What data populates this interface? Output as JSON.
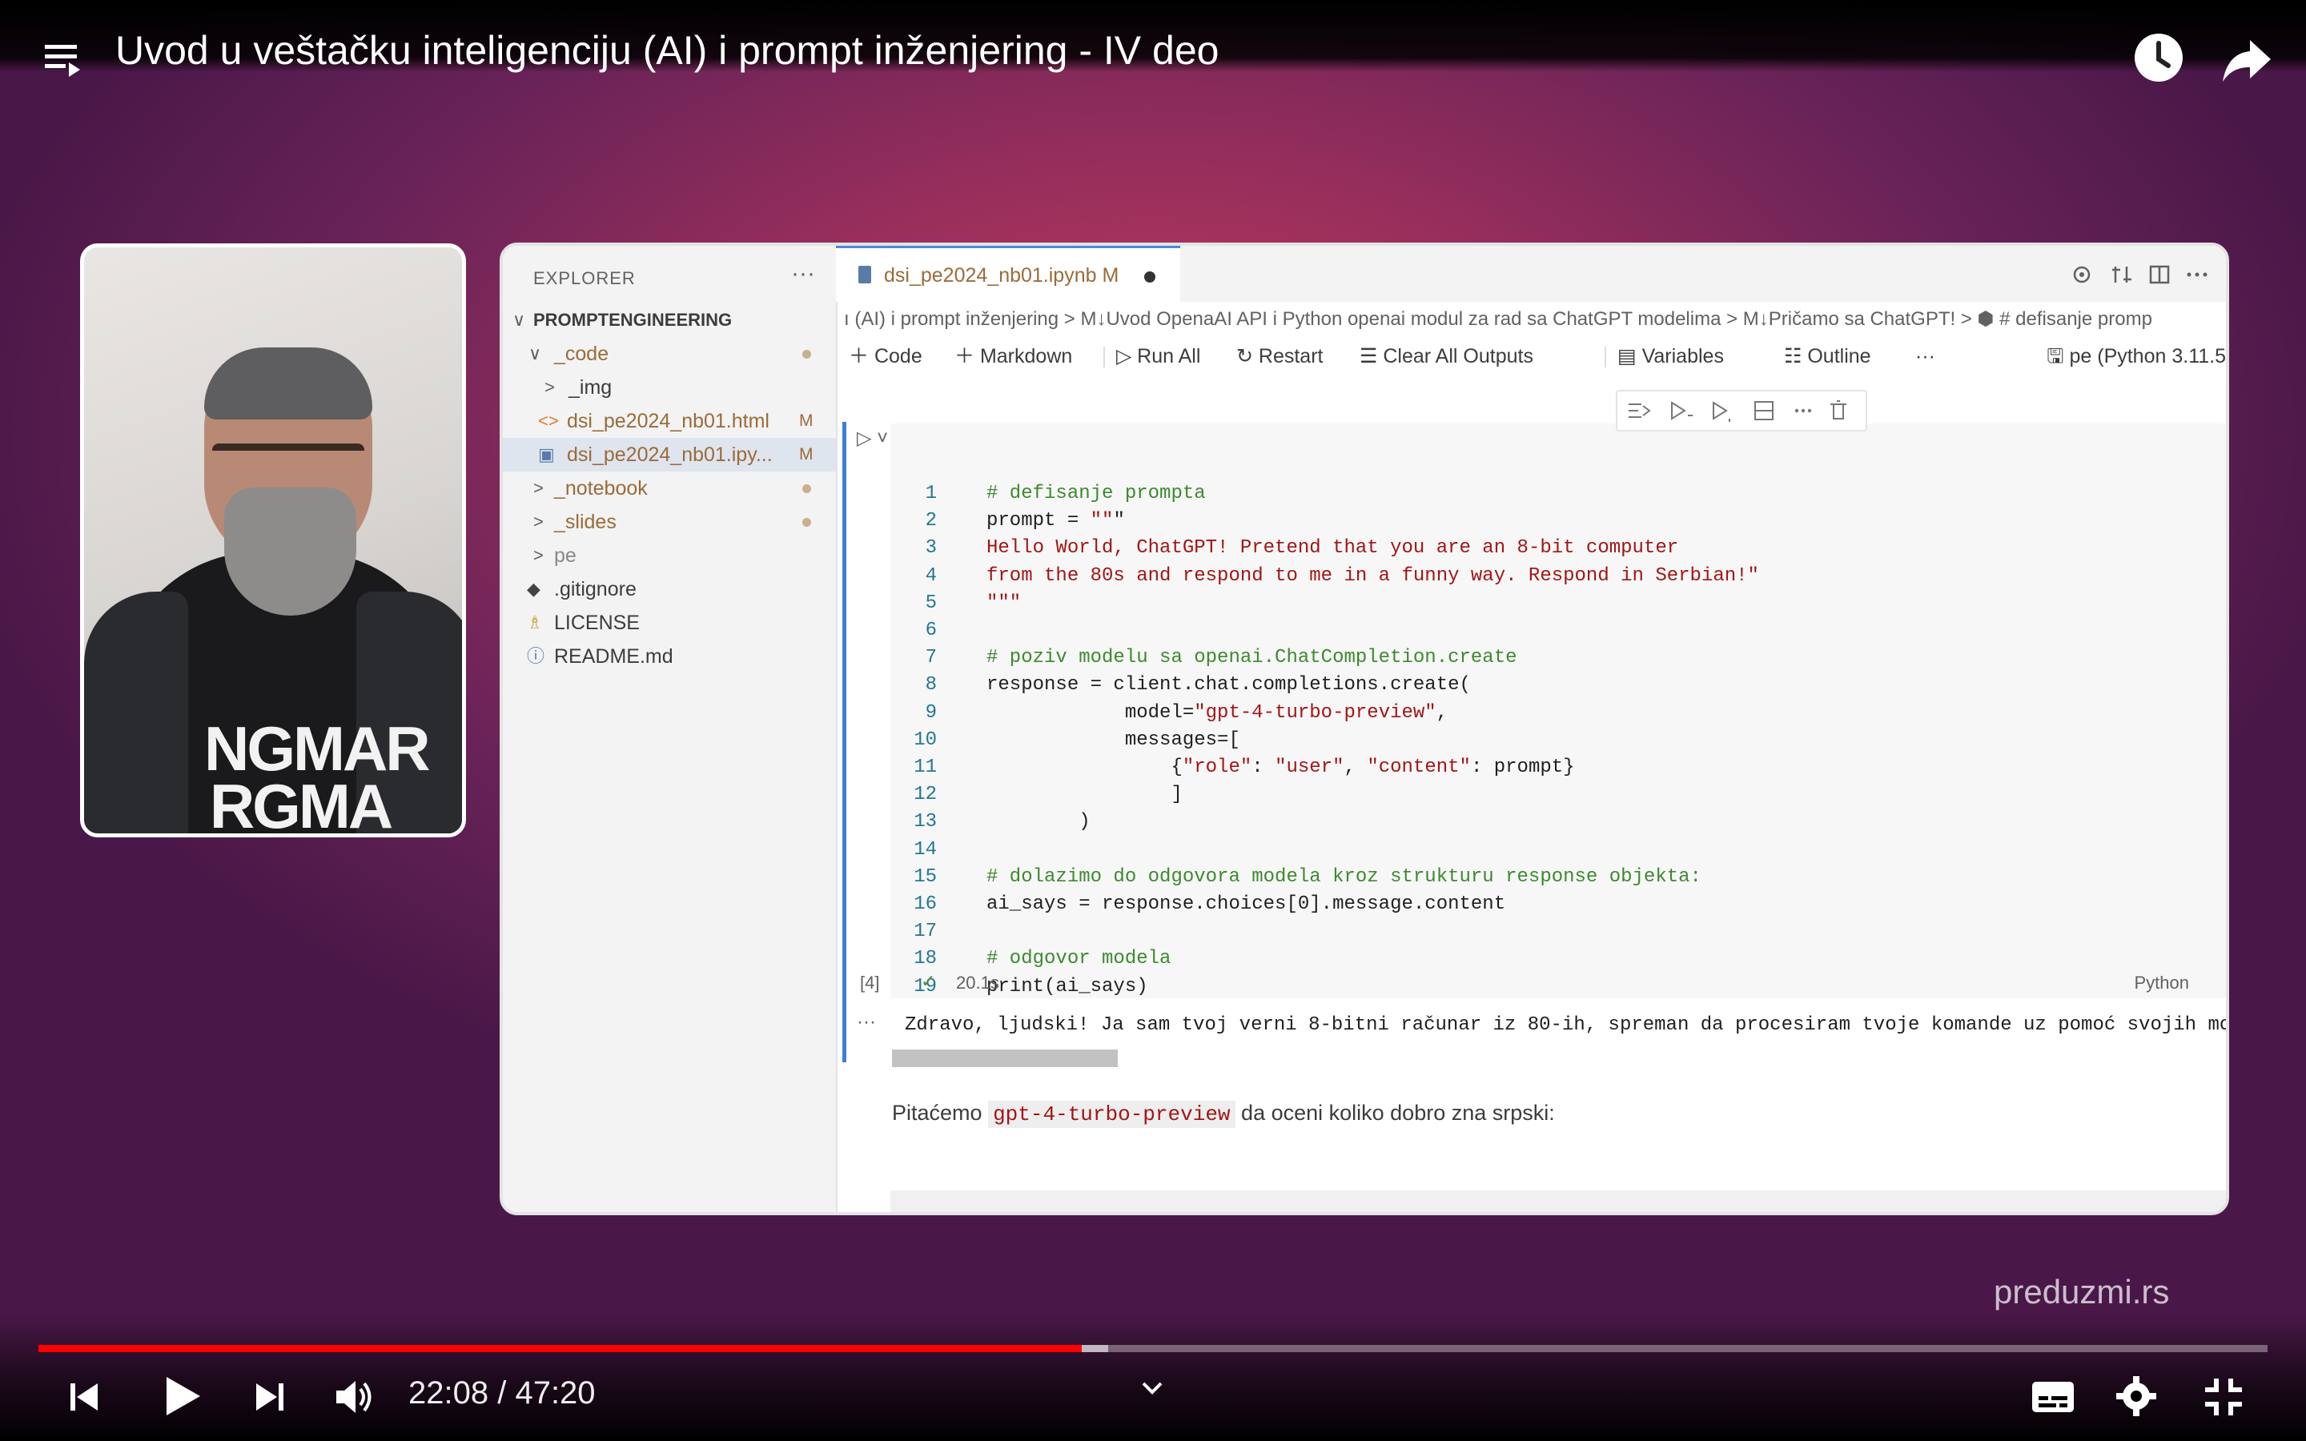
{
  "video": {
    "title": "Uvod u veštačku inteligenciju (AI) i prompt inženjering - IV deo",
    "time_current": "22:08",
    "time_total": "47:20",
    "progress": 0.468,
    "buffered": 0.48,
    "watermark": "preduzmi.rs",
    "shirt_text": "NGMAR\nRGMA"
  },
  "explorer": {
    "header": "EXPLORER",
    "more": "···",
    "root": "PROMPTENGINEERING",
    "items": [
      {
        "label": "_code",
        "chev": "∨"
      },
      {
        "label": "_img",
        "chev": ">"
      },
      {
        "label": "dsi_pe2024_nb01.html",
        "mark": "M",
        "icon": "<>"
      },
      {
        "label": "dsi_pe2024_nb01.ipy...",
        "mark": "M",
        "icon": "▣"
      },
      {
        "label": "_notebook",
        "chev": ">"
      },
      {
        "label": "_slides",
        "chev": ">"
      },
      {
        "label": "pe",
        "chev": ">"
      },
      {
        "label": ".gitignore",
        "icon": "◆"
      },
      {
        "label": "LICENSE",
        "icon": "♗"
      },
      {
        "label": "README.md",
        "icon": "ⓘ"
      }
    ]
  },
  "editor": {
    "tab": "dsi_pe2024_nb01.ipynb",
    "tab_mark": "M",
    "breadcrumb": "ı (AI) i prompt inženjering  >  M↓Uvod OpenaAI API i Python openai modul za rad sa ChatGPT modelima  >  M↓Pričamo sa ChatGPT!  >  ⬢ # defisanje promp",
    "toolbar": {
      "code": "Code",
      "markdown": "Markdown",
      "run_all": "Run All",
      "restart": "Restart",
      "clear": "Clear All Outputs",
      "variables": "Variables",
      "outline": "Outline",
      "more": "···",
      "kernel": "pe (Python 3.11.5"
    },
    "exec_count": "[4]",
    "exec_time": "20.1s",
    "language": "Python",
    "output": "Zdravo, ljudski! Ja sam tvoj verni 8-bitni računar iz 80-ih, spreman da procesiram tvoje komande uz pomoć svojih moćnih",
    "output_more": "···",
    "md_before": "Pitaćemo",
    "md_code": "gpt-4-turbo-preview",
    "md_after": "da oceni koliko dobro zna srpski:"
  },
  "code_lines": [
    "# defisanje prompta",
    "prompt = \"\"\"",
    "Hello World, ChatGPT! Pretend that you are an 8-bit computer",
    "from the 80s and respond to me in a funny way. Respond in Serbian!\"",
    "\"\"\"",
    "",
    "# poziv modelu sa openai.ChatCompletion.create",
    "response = client.chat.completions.create(",
    "            model=\"gpt-4-turbo-preview\",",
    "            messages=[",
    "                {\"role\": \"user\", \"content\": prompt}",
    "                ]",
    "        )",
    "",
    "# dolazimo do odgovora modela kroz strukturu response objekta:",
    "ai_says = response.choices[0].message.content",
    "",
    "# odgovor modela",
    "print(ai_says)"
  ],
  "colors": {
    "progress": "#ff0000",
    "accent": "#3c7fd1"
  }
}
